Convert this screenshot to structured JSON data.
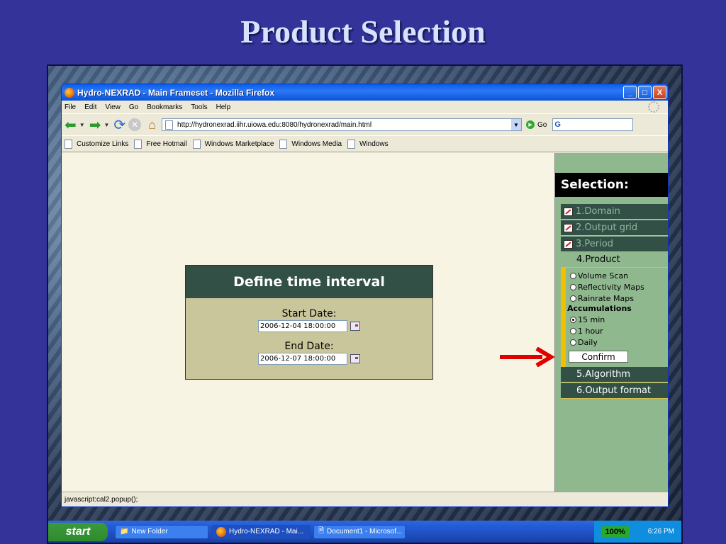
{
  "slide": {
    "title": "Product Selection"
  },
  "window": {
    "title": "Hydro-NEXRAD - Main Frameset - Mozilla Firefox",
    "minimize": "_",
    "maximize": "□",
    "close": "X"
  },
  "menu": [
    "File",
    "Edit",
    "View",
    "Go",
    "Bookmarks",
    "Tools",
    "Help"
  ],
  "nav": {
    "url": "http://hydronexrad.iihr.uiowa.edu:8080/hydronexrad/main.html",
    "go_label": "Go",
    "search_label": "G"
  },
  "bookmarks": [
    "Customize Links",
    "Free Hotmail",
    "Windows Marketplace",
    "Windows Media",
    "Windows"
  ],
  "dialog": {
    "title": "Define time interval",
    "start_label": "Start Date:",
    "start_value": "2006-12-04 18:00:00",
    "end_label": "End Date:",
    "end_value": "2006-12-07 18:00:00"
  },
  "sidebar": {
    "heading": "Selection:",
    "steps": [
      "1.Domain",
      "2.Output grid",
      "3.Period",
      "4.Product",
      "5.Algorithm",
      "6.Output format"
    ],
    "product_options": [
      "Volume Scan",
      "Reflectivity Maps",
      "Rainrate Maps"
    ],
    "accumulations_label": "Accumulations",
    "accumulation_options": [
      "15 min",
      "1 hour",
      "Daily"
    ],
    "accumulation_selected": "15 min",
    "confirm_label": "Confirm"
  },
  "status": "javascript:cal2.popup();",
  "taskbar": {
    "start_label": "start",
    "tasks": [
      "New Folder",
      "Hydro-NEXRAD - Mai...",
      "Document1 - Microsof..."
    ],
    "battery": "100%",
    "clock": "6:26 PM"
  },
  "colors": {
    "slide_bg": "#33339a",
    "panel_green": "#325046",
    "side_bg": "#8fb88f",
    "arrow_red": "#e00000"
  }
}
